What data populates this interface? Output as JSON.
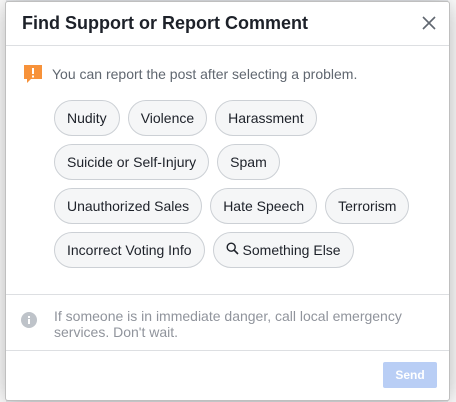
{
  "dialog": {
    "title": "Find Support or Report Comment",
    "prompt": "You can report the post after selecting a problem.",
    "options": [
      {
        "label": "Nudity",
        "icon": null
      },
      {
        "label": "Violence",
        "icon": null
      },
      {
        "label": "Harassment",
        "icon": null
      },
      {
        "label": "Suicide or Self-Injury",
        "icon": null
      },
      {
        "label": "Spam",
        "icon": null
      },
      {
        "label": "Unauthorized Sales",
        "icon": null
      },
      {
        "label": "Hate Speech",
        "icon": null
      },
      {
        "label": "Terrorism",
        "icon": null
      },
      {
        "label": "Incorrect Voting Info",
        "icon": null
      },
      {
        "label": "Something Else",
        "icon": "search-icon"
      }
    ],
    "info": "If someone is in immediate danger, call local emergency services. Don't wait.",
    "send_label": "Send"
  },
  "colors": {
    "warning": "#f7923a",
    "send_disabled": "#b9cef5",
    "chip_border": "#ccd0d5",
    "link": "#365899"
  }
}
